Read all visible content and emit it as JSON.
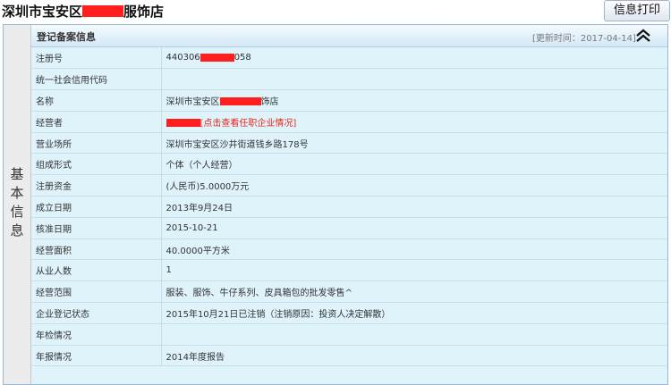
{
  "header": {
    "title_prefix": "深圳市宝安区",
    "title_suffix": "服饰店",
    "print_button": "信息打印"
  },
  "side_label": "基本信息",
  "section": {
    "title": "登记备案信息",
    "update_time": "[更新时间：2017-04-14]"
  },
  "rows": [
    {
      "label": "注册号",
      "value_prefix": "440306",
      "value_suffix": "058"
    },
    {
      "label": "统一社会信用代码",
      "value": ""
    },
    {
      "label": "名称",
      "value_prefix": "深圳市宝安区",
      "value_suffix": "饰店"
    },
    {
      "label": "经营者",
      "link_text": "[点击查看任职企业情况]"
    },
    {
      "label": "营业场所",
      "value": "深圳市宝安区沙井街道钱乡路178号"
    },
    {
      "label": "组成形式",
      "value": "个体（个人经营）"
    },
    {
      "label": "注册资金",
      "value": "(人民币)5.0000万元"
    },
    {
      "label": "成立日期",
      "value": "2013年9月24日"
    },
    {
      "label": "核准日期",
      "value": "2015-10-21"
    },
    {
      "label": "经营面积",
      "value": "40.0000平方米"
    },
    {
      "label": "从业人数",
      "value": "1"
    },
    {
      "label": "经营范围",
      "value": "服装、服饰、牛仔系列、皮具箱包的批发零售^"
    },
    {
      "label": "企业登记状态",
      "value": "2015年10月21日已注销（注销原因：投资人决定解散）"
    },
    {
      "label": "年检情况",
      "value": ""
    },
    {
      "label": "年报情况",
      "value": "2014年度报告"
    }
  ],
  "colors": {
    "row_background": "#dff3fb",
    "redaction": "#ff1f1f",
    "link": "#e8281b"
  },
  "icons": {
    "collapse": "double-chevron-up-icon"
  }
}
